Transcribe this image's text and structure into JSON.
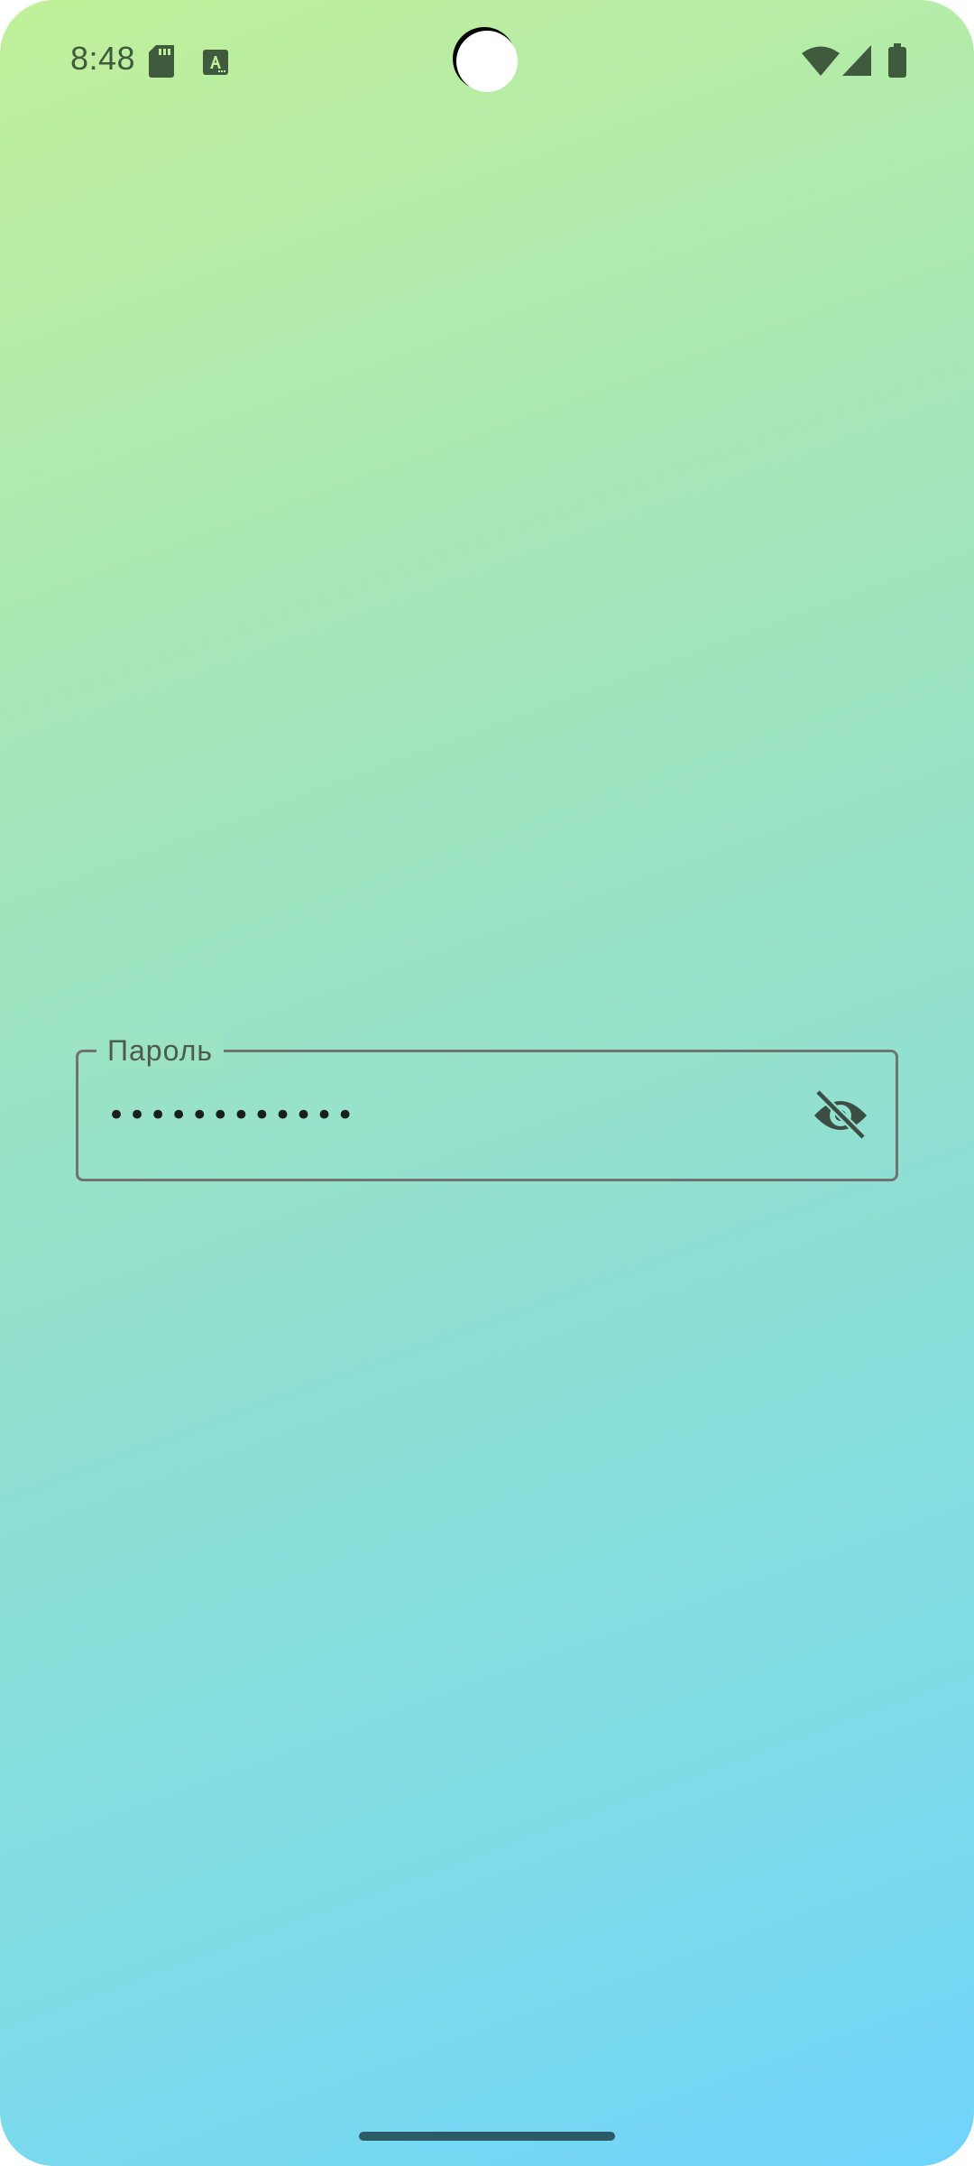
{
  "status_bar": {
    "time": "8:48",
    "left_icons": [
      "sd-card-icon",
      "keyboard-a-icon"
    ],
    "right_icons": [
      "wifi-icon",
      "signal-icon",
      "battery-icon"
    ]
  },
  "password_field": {
    "label": "Пароль",
    "value": "••••••••••••",
    "toggle_icon": "visibility-off-icon"
  },
  "colors": {
    "gradient_start": "#c2f09a",
    "gradient_end": "#70d4fb",
    "icon_color": "#3f5a3c",
    "field_border": "#6f7470"
  }
}
